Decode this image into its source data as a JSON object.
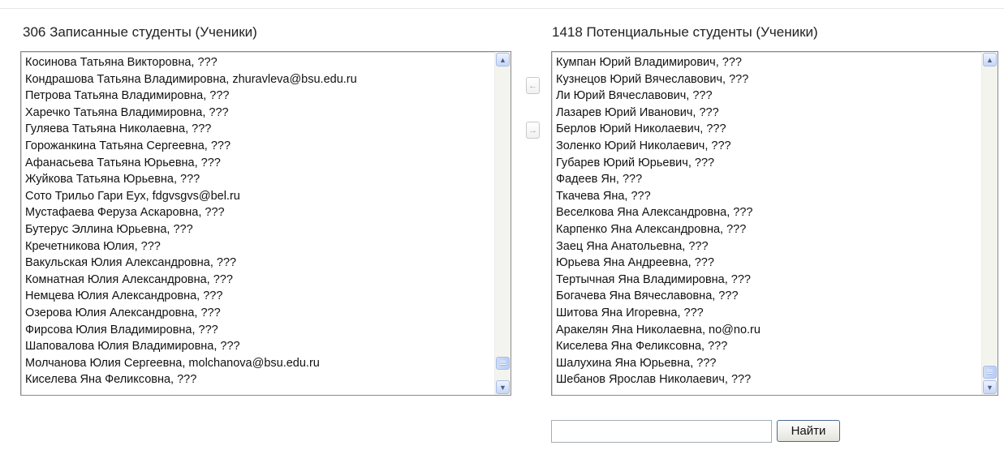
{
  "enrolled": {
    "title": "306 Записанные студенты (Ученики)",
    "items": [
      "Косинова Татьяна Викторовна, ???",
      "Кондрашова Татьяна Владимировна, zhuravleva@bsu.edu.ru",
      "Петрова Татьяна Владимировна, ???",
      "Харечко Татьяна Владимировна, ???",
      "Гуляева Татьяна Николаевна, ???",
      "Горожанкина Татьяна Сергеевна, ???",
      "Афанасьева Татьяна Юрьевна, ???",
      "Жуйкова Татьяна Юрьевна, ???",
      "Сото Трильо Гари Еух, fdgvsgvs@bel.ru",
      "Мустафаева Феруза Аскаровна, ???",
      "Бутерус Эллина Юрьевна, ???",
      "Кречетникова Юлия, ???",
      "Вакульская Юлия Александровна, ???",
      "Комнатная Юлия Александровна, ???",
      "Немцева Юлия Александровна, ???",
      "Озерова Юлия Александровна, ???",
      "Фирсова Юлия Владимировна, ???",
      "Шаповалова Юлия Владимировна, ???",
      "Молчанова Юлия Сергеевна, molchanova@bsu.edu.ru",
      "Киселева Яна Феликсовна, ???"
    ],
    "scroll_position": 0.97
  },
  "potential": {
    "title": "1418 Потенциальные студенты (Ученики)",
    "items": [
      "Кумпан Юрий Владимирович, ???",
      "Кузнецов Юрий Вячеславович, ???",
      "Ли Юрий Вячеславович, ???",
      "Лазарев Юрий Иванович, ???",
      "Берлов Юрий Николаевич, ???",
      "Золенко Юрий Николаевич, ???",
      "Губарев Юрий Юрьевич, ???",
      "Фадеев Ян, ???",
      "Ткачева Яна, ???",
      "Веселкова Яна Александровна, ???",
      "Карпенко Яна Александровна, ???",
      "Заец Яна Анатольевна, ???",
      "Юрьева Яна Андреевна, ???",
      "Тертычная Яна Владимировна, ???",
      "Богачева Яна Вячеславовна, ???",
      "Шитова Яна Игоревна, ???",
      "Аракелян Яна Николаевна, no@no.ru",
      "Киселева Яна Феликсовна, ???",
      "Шалухина Яна Юрьевна, ???",
      "Шебанов Ярослав Николаевич, ???"
    ],
    "scroll_position": 1.0
  },
  "controls": {
    "add_symbol": "←",
    "remove_symbol": "→",
    "search_value": "",
    "search_button": "Найти"
  },
  "icons": {
    "scroll_up": "chevron-up-icon",
    "scroll_down": "chevron-down-icon",
    "add": "arrow-left-icon",
    "remove": "arrow-right-icon"
  }
}
